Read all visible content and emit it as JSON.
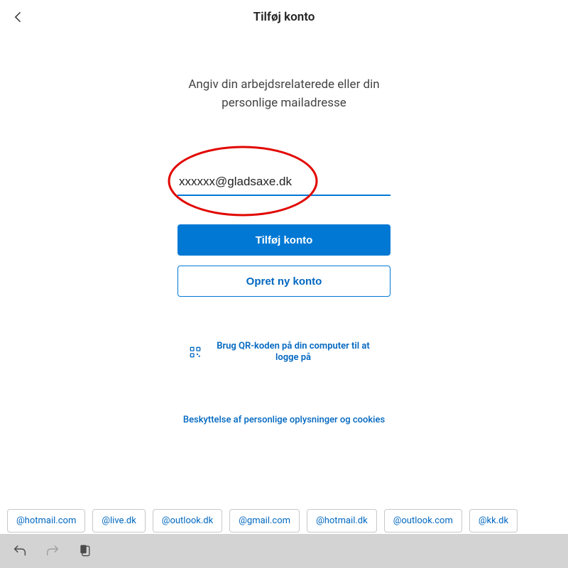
{
  "header": {
    "title": "Tilføj konto"
  },
  "instructions": {
    "line1": "Angiv din arbejdsrelaterede eller din",
    "line2": "personlige mailadresse"
  },
  "email": {
    "value": "xxxxxx@gladsaxe.dk"
  },
  "buttons": {
    "primary": "Tilføj konto",
    "secondary": "Opret ny konto"
  },
  "qr": {
    "text": "Brug QR-koden på din computer til at logge på"
  },
  "privacy": {
    "text": "Beskyttelse af personlige oplysninger og cookies"
  },
  "suggestions": [
    "@hotmail.com",
    "@live.dk",
    "@outlook.dk",
    "@gmail.com",
    "@hotmail.dk",
    "@outlook.com",
    "@kk.dk"
  ],
  "colors": {
    "accent": "#0078d4",
    "annotation": "#e10600"
  }
}
